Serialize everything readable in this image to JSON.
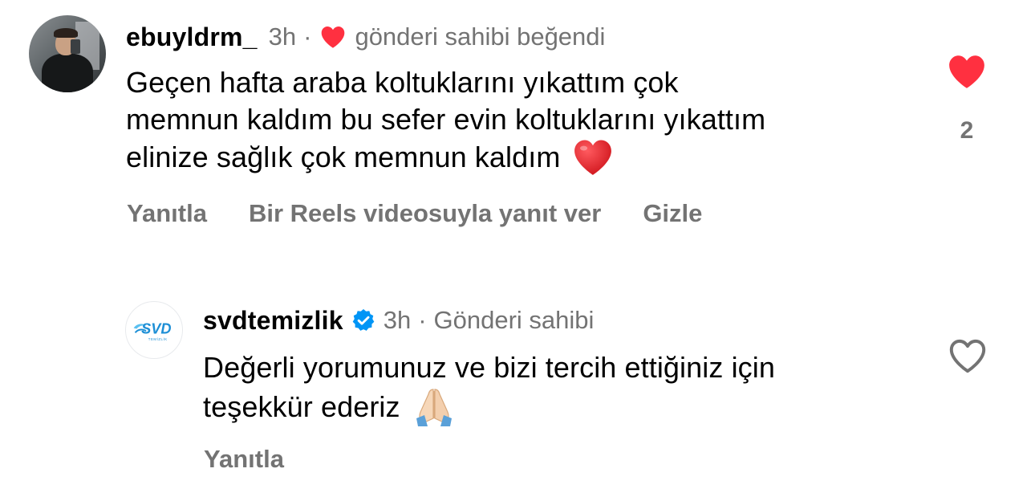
{
  "comment": {
    "username": "ebuyldrm_",
    "time": "3h",
    "separator": "·",
    "liked_by_author_text": "gönderi sahibi beğendi",
    "text_lines": [
      "Geçen hafta araba koltuklarını yıkattım çok",
      "memnun kaldım bu sefer evin koltuklarını yıkattım",
      "elinize sağlık çok memnun kaldım"
    ],
    "emoji": "heart",
    "like_count": "2",
    "liked": true,
    "actions": {
      "reply": "Yanıtla",
      "reels_reply": "Bir Reels videosuyla yanıt ver",
      "hide": "Gizle"
    }
  },
  "reply": {
    "username": "svdtemizlik",
    "verified": true,
    "time": "3h",
    "separator": "·",
    "author_tag": "Gönderi sahibi",
    "avatar_logo_text": "SVD",
    "avatar_logo_subtext": "TEMİZLİK",
    "text_lines": [
      "Değerli yorumunuz ve bizi tercih ettiğiniz için",
      "teşekkür ederiz"
    ],
    "emoji": "folded-hands",
    "liked": false,
    "actions": {
      "reply": "Yanıtla"
    }
  },
  "colors": {
    "heart_red": "#ff3040",
    "emoji_red": "#e0262b",
    "secondary_text": "#737373",
    "verified_blue": "#0095f6",
    "brand_blue": "#1d8fd6"
  }
}
